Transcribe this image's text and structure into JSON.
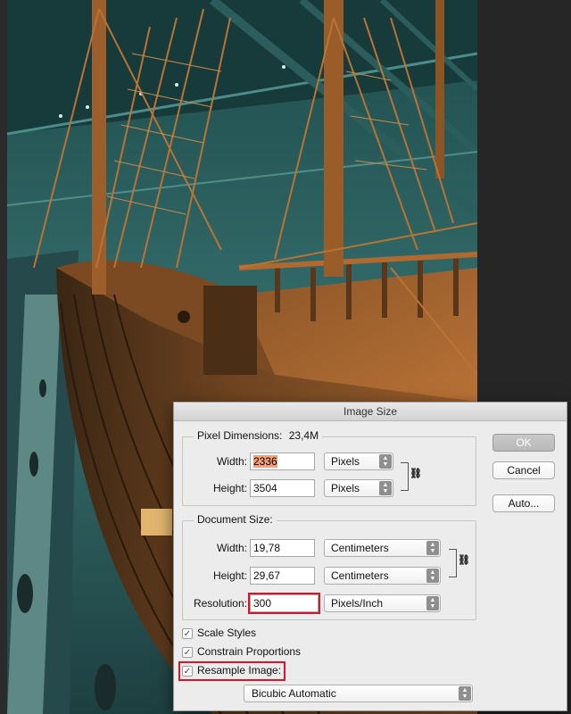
{
  "dialog": {
    "title": "Image Size",
    "pixel_dimensions": {
      "label": "Pixel Dimensions:",
      "size": "23,4M",
      "width_label": "Width:",
      "width_value": "2336",
      "width_unit": "Pixels",
      "height_label": "Height:",
      "height_value": "3504",
      "height_unit": "Pixels"
    },
    "document_size": {
      "label": "Document Size:",
      "width_label": "Width:",
      "width_value": "19,78",
      "width_unit": "Centimeters",
      "height_label": "Height:",
      "height_value": "29,67",
      "height_unit": "Centimeters",
      "resolution_label": "Resolution:",
      "resolution_value": "300",
      "resolution_unit": "Pixels/Inch"
    },
    "options": {
      "scale_styles": "Scale Styles",
      "constrain_proportions": "Constrain Proportions",
      "resample_image": "Resample Image:",
      "resample_method": "Bicubic Automatic"
    },
    "buttons": {
      "ok": "OK",
      "cancel": "Cancel",
      "auto": "Auto..."
    }
  },
  "icons": {
    "checkmark": "✓",
    "link": "chain-link-icon",
    "select_arrows": "up-down-arrows-icon"
  },
  "colors": {
    "selection_highlight": "#f4a07c",
    "annotation_red": "#d9152b",
    "ship_wood": "#a4622c",
    "hall_teal": "#3c7a78"
  }
}
